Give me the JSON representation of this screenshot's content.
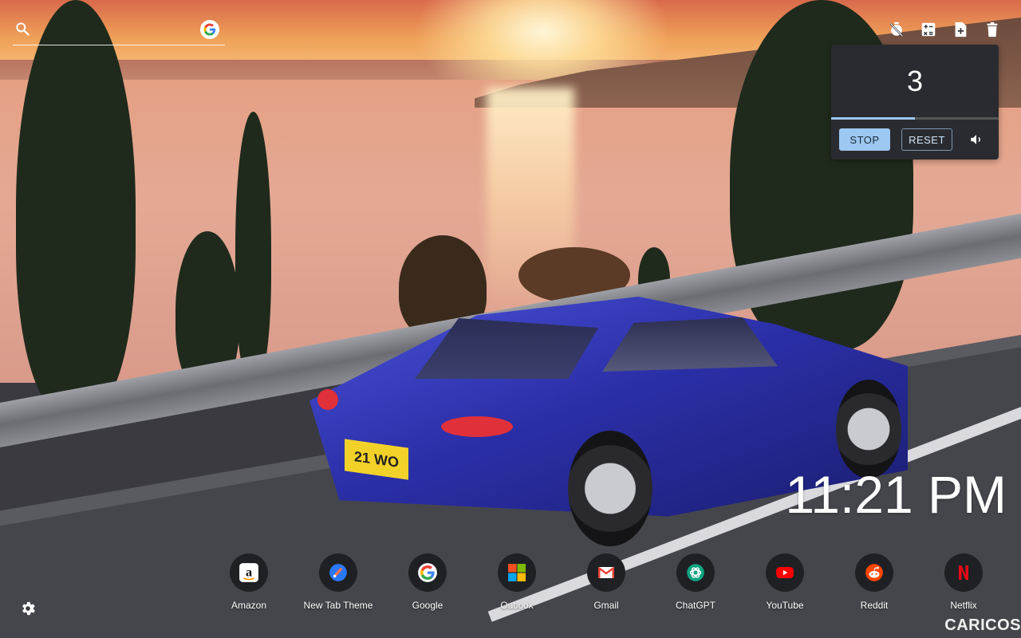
{
  "search": {
    "placeholder": "",
    "value": "",
    "engine_icon": "google-icon"
  },
  "toolbar": {
    "items": [
      {
        "icon": "timer-off-icon"
      },
      {
        "icon": "calculator-icon"
      },
      {
        "icon": "new-note-icon"
      },
      {
        "icon": "trash-icon"
      }
    ]
  },
  "timer": {
    "value": "3",
    "progress_fraction": 0.5,
    "stop_label": "STOP",
    "reset_label": "RESET",
    "sound_icon": "volume-icon"
  },
  "clock": {
    "time": "11:21 PM"
  },
  "shortcuts": [
    {
      "label": "Amazon",
      "icon": "amazon-icon",
      "color": "#ffffff"
    },
    {
      "label": "New Tab Theme",
      "icon": "new-tab-theme-icon",
      "color": "#2979ff"
    },
    {
      "label": "Google",
      "icon": "google-icon",
      "color": "#ffffff"
    },
    {
      "label": "Outlook",
      "icon": "microsoft-icon",
      "color": "#f25022"
    },
    {
      "label": "Gmail",
      "icon": "gmail-icon",
      "color": "#ea4335"
    },
    {
      "label": "ChatGPT",
      "icon": "chatgpt-icon",
      "color": "#10a37f"
    },
    {
      "label": "YouTube",
      "icon": "youtube-icon",
      "color": "#ff0000"
    },
    {
      "label": "Reddit",
      "icon": "reddit-icon",
      "color": "#ff4500"
    },
    {
      "label": "Netflix",
      "icon": "netflix-icon",
      "color": "#e50914"
    }
  ],
  "background": {
    "plate_text": "21 WO"
  },
  "watermark": "CARICOS",
  "colors": {
    "accent": "#9cc8f2",
    "panel": "#2a2b30"
  }
}
